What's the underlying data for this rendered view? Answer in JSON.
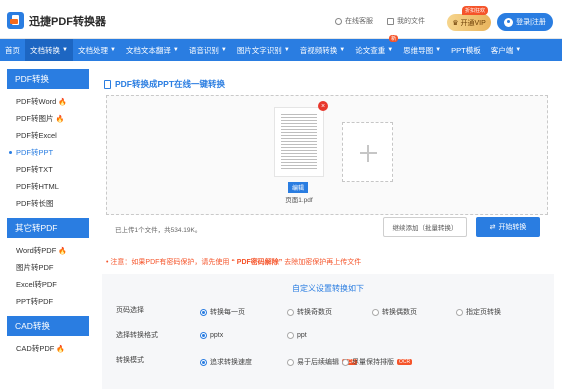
{
  "header": {
    "app_name": "迅捷PDF转换器",
    "links": [
      {
        "label": "在线客服",
        "icon": "headset-icon"
      },
      {
        "label": "我的文件",
        "icon": "folder-icon"
      }
    ],
    "vip_label": "开通VIP",
    "vip_tag": "折扣狂欢",
    "login_label": "登录|注册"
  },
  "nav": {
    "items": [
      {
        "label": "首页",
        "caret": ""
      },
      {
        "label": "文档转换",
        "caret": "▼"
      },
      {
        "label": "文档处理",
        "caret": "▼"
      },
      {
        "label": "文档文本翻译",
        "caret": "▼"
      },
      {
        "label": "语音识别",
        "caret": "▼"
      },
      {
        "label": "图片文字识别",
        "caret": "▼"
      },
      {
        "label": "音视频转换",
        "caret": "▼"
      },
      {
        "label": "论文查重",
        "caret": "▼"
      },
      {
        "label": "思维导图",
        "caret": "▼"
      },
      {
        "label": "PPT模板",
        "caret": ""
      },
      {
        "label": "客户端",
        "caret": "▼"
      }
    ],
    "badge": "新"
  },
  "sidebar": {
    "groups": [
      {
        "title": "PDF转换",
        "items": [
          {
            "label": "PDF转Word",
            "hot": true
          },
          {
            "label": "PDF转图片",
            "hot": true
          },
          {
            "label": "PDF转Excel",
            "hot": false
          },
          {
            "label": "PDF转PPT",
            "hot": false
          },
          {
            "label": "PDF转TXT",
            "hot": false
          },
          {
            "label": "PDF转HTML",
            "hot": false
          },
          {
            "label": "PDF转长图",
            "hot": false
          }
        ]
      },
      {
        "title": "其它转PDF",
        "items": [
          {
            "label": "Word转PDF",
            "hot": true
          },
          {
            "label": "图片转PDF",
            "hot": false
          },
          {
            "label": "Excel转PDF",
            "hot": false
          },
          {
            "label": "PPT转PDF",
            "hot": false
          }
        ]
      },
      {
        "title": "CAD转换",
        "items": [
          {
            "label": "CAD转PDF",
            "hot": true
          }
        ]
      }
    ],
    "hot_glyph": "🔥"
  },
  "main": {
    "title": "PDF转换成PPT在线一键转换",
    "file": {
      "name": "页面1.pdf",
      "edit_label": "编辑",
      "close_glyph": "×"
    },
    "upload_info": "已上传1个文件，共534.19K。",
    "continue_label": "继续添加（批量转换）",
    "start_label": "开始转换",
    "note_prefix": "注意：如果PDF有密码保护，请先使用",
    "note_link": "“ PDF密码解除”",
    "note_suffix": "去除加密保护再上传文件"
  },
  "settings": {
    "title": "自定义设置转换如下",
    "rows": [
      {
        "label": "页码选择",
        "options": [
          {
            "label": "转换每一页",
            "checked": true,
            "ocr": false
          },
          {
            "label": "转换奇数页",
            "checked": false,
            "ocr": false
          },
          {
            "label": "转换偶数页",
            "checked": false,
            "ocr": false
          },
          {
            "label": "指定页转换",
            "checked": false,
            "ocr": false
          }
        ]
      },
      {
        "label": "选择转换格式",
        "options": [
          {
            "label": "pptx",
            "checked": true,
            "ocr": false
          },
          {
            "label": "ppt",
            "checked": false,
            "ocr": false
          }
        ]
      },
      {
        "label": "转换模式",
        "options": [
          {
            "label": "追求转换速度",
            "checked": true,
            "ocr": false
          },
          {
            "label": "易于后续编辑",
            "checked": false,
            "ocr": true
          },
          {
            "label": "尽量保持排版",
            "checked": false,
            "ocr": true
          }
        ]
      }
    ],
    "ocr_label": "OCR"
  },
  "colors": {
    "primary": "#2a7de1",
    "accent": "#f5542a",
    "vip_gold": "#e9b45d"
  }
}
